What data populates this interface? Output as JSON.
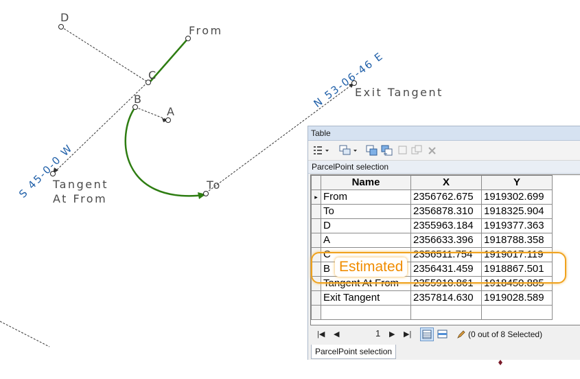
{
  "map": {
    "labels": {
      "d": "D",
      "from": "From",
      "c": "C",
      "b": "B",
      "a": "A",
      "to": "To",
      "tangent_line1": "Tangent",
      "tangent_line2": "At From",
      "exit_tangent": "Exit Tangent"
    },
    "bearings": {
      "exit": "N 53-06-46 E",
      "entry": "S 45-0-0 W"
    },
    "colors": {
      "curve": "#2e7d12",
      "bearing_text": "#1f5fa8",
      "dashed": "#333333"
    }
  },
  "table_window": {
    "title": "Table",
    "toolbar": {
      "options_icon": "table-options-icon",
      "related_icon": "related-tables-icon",
      "select_by_attr_icon": "select-by-attributes-icon",
      "switch_selection_icon": "switch-selection-icon",
      "clear_selection_icon": "clear-selection-icon",
      "copy_icon": "copy-selected-icon",
      "delete_icon": "delete-selected-icon"
    },
    "caption": "ParcelPoint selection",
    "columns": [
      "Name",
      "X",
      "Y"
    ],
    "rows": [
      {
        "name": "From",
        "x": "2356762.675",
        "y": "1919302.699"
      },
      {
        "name": "To",
        "x": "2356878.310",
        "y": "1918325.904"
      },
      {
        "name": "D",
        "x": "2355963.184",
        "y": "1919377.363"
      },
      {
        "name": "A",
        "x": "2356633.396",
        "y": "1918788.358"
      },
      {
        "name": "C",
        "x": "2356511.754",
        "y": "1919017.119"
      },
      {
        "name": "B",
        "x": "2356431.459",
        "y": "1918867.501"
      },
      {
        "name": "Tangent At From",
        "x": "2355910.861",
        "y": "1918450.885"
      },
      {
        "name": "Exit Tangent",
        "x": "2357814.630",
        "y": "1919028.589"
      }
    ],
    "navigator": {
      "page": "1",
      "status": "(0 out of 8 Selected)"
    },
    "bottom_tab": "ParcelPoint selection"
  },
  "annotation": {
    "label": "Estimated",
    "color": "#f0a21c"
  }
}
